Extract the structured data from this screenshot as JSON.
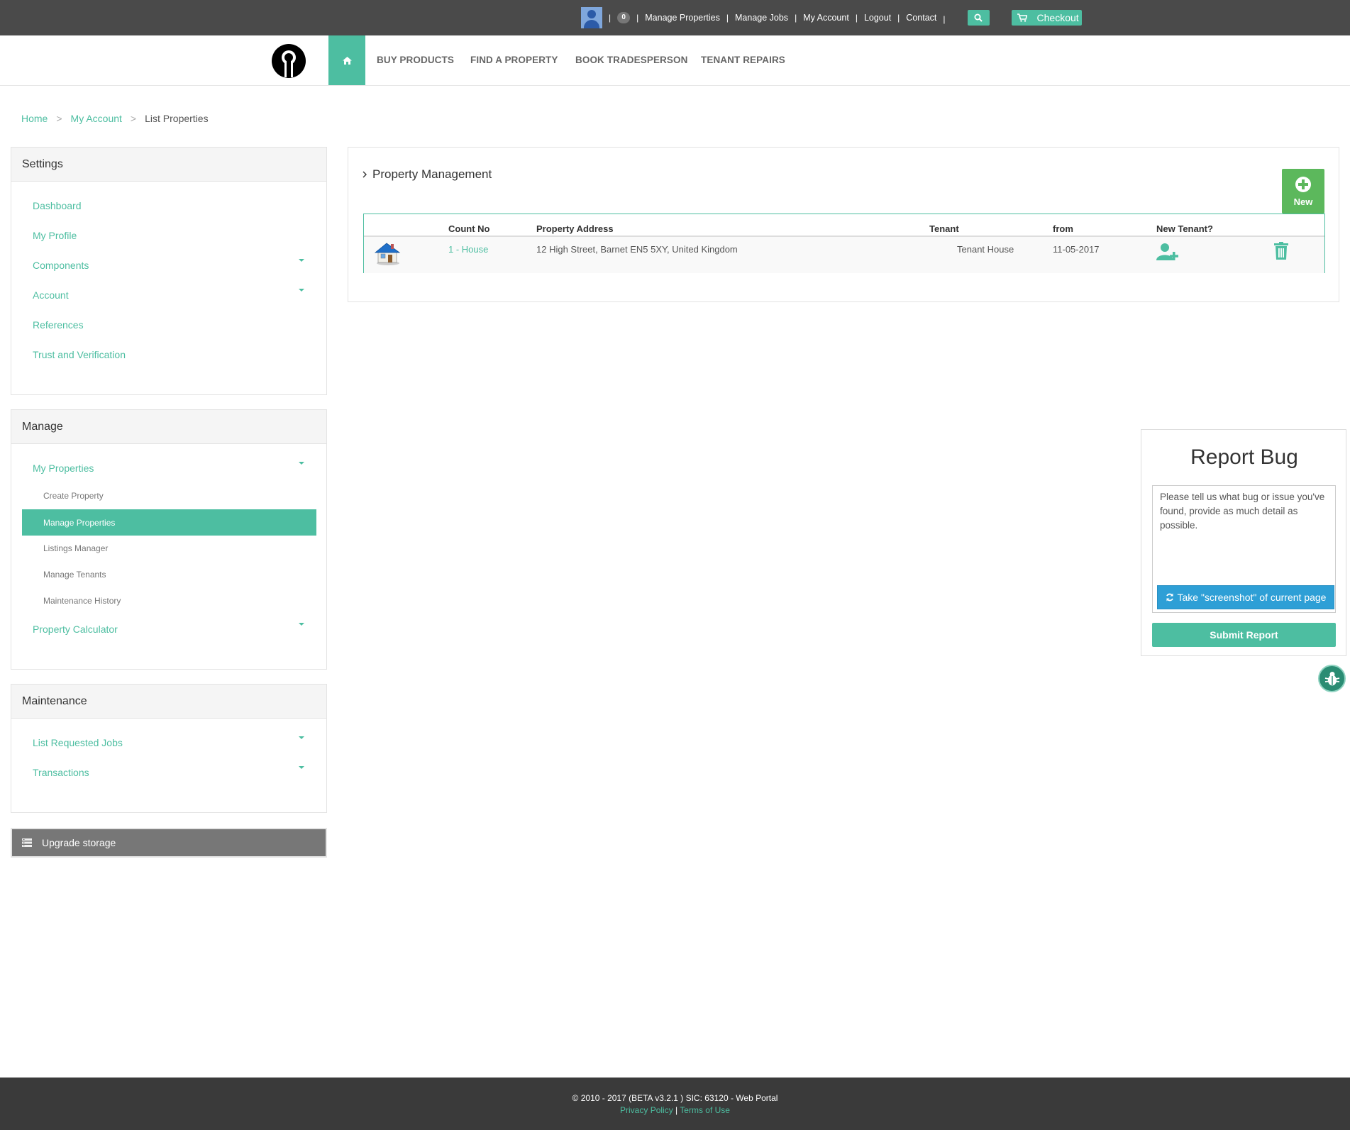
{
  "topbar": {
    "notification_count": "0",
    "links": [
      "Manage Properties",
      "Manage Jobs",
      "My Account",
      "Logout",
      "Contact"
    ],
    "checkout_label": "Checkout"
  },
  "nav": {
    "items": [
      "BUY PRODUCTS",
      "FIND A PROPERTY",
      "BOOK TRADESPERSON",
      "TENANT REPAIRS"
    ]
  },
  "breadcrumb": {
    "home": "Home",
    "account": "My Account",
    "current": "List Properties",
    "separator": ">"
  },
  "settings": {
    "title": "Settings",
    "items": [
      "Dashboard",
      "My Profile",
      "Components",
      "Account",
      "References",
      "Trust and Verification"
    ]
  },
  "manage": {
    "title": "Manage",
    "my_properties": "My Properties",
    "sub_items": [
      "Create Property",
      "Manage Properties",
      "Listings Manager",
      "Manage Tenants",
      "Maintenance History"
    ],
    "active_sub": "Manage Properties",
    "property_calculator": "Property Calculator"
  },
  "maintenance": {
    "title": "Maintenance",
    "items": [
      "List Requested Jobs",
      "Transactions"
    ]
  },
  "upgrade_label": "Upgrade storage",
  "main": {
    "title": "Property Management",
    "new_label": "New",
    "columns": [
      "Count No",
      "Property Address",
      "Tenant",
      "from",
      "New Tenant?"
    ],
    "rows": [
      {
        "count_no": "1 - House",
        "address": "12 High Street, Barnet EN5 5XY, United Kingdom",
        "tenant": "Tenant House",
        "from": "11-05-2017"
      }
    ]
  },
  "report_bug": {
    "title": "Report Bug",
    "placeholder": "Please tell us what bug or issue you've found, provide as much detail as possible.",
    "screenshot_label": "Take \"screenshot\" of current page",
    "submit_label": "Submit Report"
  },
  "footer": {
    "copyright": "© 2010 - 2017 (BETA v3.2.1 ) SIC: 63120 - Web Portal",
    "privacy": "Privacy Policy",
    "divider": "|",
    "terms": "Terms of Use"
  },
  "colors": {
    "accent": "#4dbea1",
    "topbar": "#4a4a4a",
    "new_button": "#5cb85c",
    "screenshot_button": "#2e9fd6",
    "footer": "#3a3a3a"
  }
}
